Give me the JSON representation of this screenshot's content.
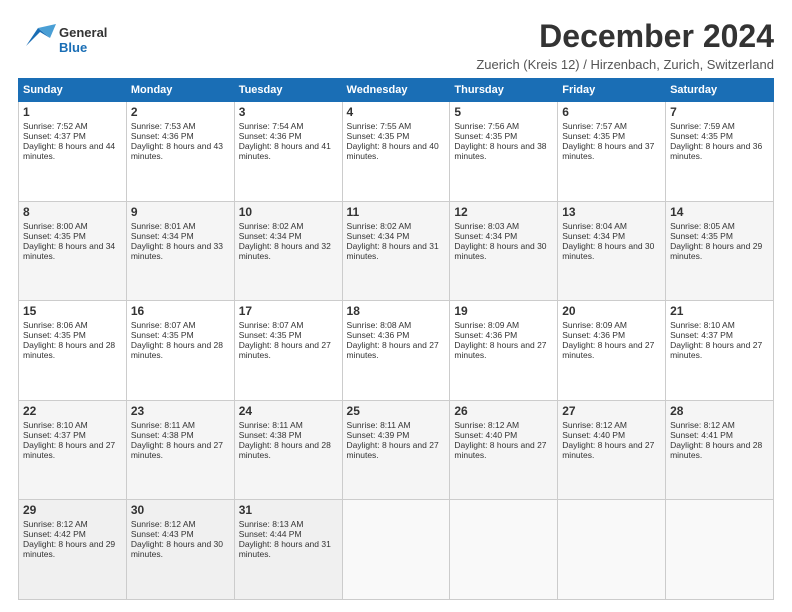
{
  "header": {
    "logo_general": "General",
    "logo_blue": "Blue",
    "month_title": "December 2024",
    "location": "Zuerich (Kreis 12) / Hirzenbach, Zurich, Switzerland"
  },
  "weekdays": [
    "Sunday",
    "Monday",
    "Tuesday",
    "Wednesday",
    "Thursday",
    "Friday",
    "Saturday"
  ],
  "weeks": [
    [
      {
        "day": "1",
        "sun": "Sunrise: 7:52 AM",
        "set": "Sunset: 4:37 PM",
        "day_light": "Daylight: 8 hours and 44 minutes."
      },
      {
        "day": "2",
        "sun": "Sunrise: 7:53 AM",
        "set": "Sunset: 4:36 PM",
        "day_light": "Daylight: 8 hours and 43 minutes."
      },
      {
        "day": "3",
        "sun": "Sunrise: 7:54 AM",
        "set": "Sunset: 4:36 PM",
        "day_light": "Daylight: 8 hours and 41 minutes."
      },
      {
        "day": "4",
        "sun": "Sunrise: 7:55 AM",
        "set": "Sunset: 4:35 PM",
        "day_light": "Daylight: 8 hours and 40 minutes."
      },
      {
        "day": "5",
        "sun": "Sunrise: 7:56 AM",
        "set": "Sunset: 4:35 PM",
        "day_light": "Daylight: 8 hours and 38 minutes."
      },
      {
        "day": "6",
        "sun": "Sunrise: 7:57 AM",
        "set": "Sunset: 4:35 PM",
        "day_light": "Daylight: 8 hours and 37 minutes."
      },
      {
        "day": "7",
        "sun": "Sunrise: 7:59 AM",
        "set": "Sunset: 4:35 PM",
        "day_light": "Daylight: 8 hours and 36 minutes."
      }
    ],
    [
      {
        "day": "8",
        "sun": "Sunrise: 8:00 AM",
        "set": "Sunset: 4:35 PM",
        "day_light": "Daylight: 8 hours and 34 minutes."
      },
      {
        "day": "9",
        "sun": "Sunrise: 8:01 AM",
        "set": "Sunset: 4:34 PM",
        "day_light": "Daylight: 8 hours and 33 minutes."
      },
      {
        "day": "10",
        "sun": "Sunrise: 8:02 AM",
        "set": "Sunset: 4:34 PM",
        "day_light": "Daylight: 8 hours and 32 minutes."
      },
      {
        "day": "11",
        "sun": "Sunrise: 8:02 AM",
        "set": "Sunset: 4:34 PM",
        "day_light": "Daylight: 8 hours and 31 minutes."
      },
      {
        "day": "12",
        "sun": "Sunrise: 8:03 AM",
        "set": "Sunset: 4:34 PM",
        "day_light": "Daylight: 8 hours and 30 minutes."
      },
      {
        "day": "13",
        "sun": "Sunrise: 8:04 AM",
        "set": "Sunset: 4:34 PM",
        "day_light": "Daylight: 8 hours and 30 minutes."
      },
      {
        "day": "14",
        "sun": "Sunrise: 8:05 AM",
        "set": "Sunset: 4:35 PM",
        "day_light": "Daylight: 8 hours and 29 minutes."
      }
    ],
    [
      {
        "day": "15",
        "sun": "Sunrise: 8:06 AM",
        "set": "Sunset: 4:35 PM",
        "day_light": "Daylight: 8 hours and 28 minutes."
      },
      {
        "day": "16",
        "sun": "Sunrise: 8:07 AM",
        "set": "Sunset: 4:35 PM",
        "day_light": "Daylight: 8 hours and 28 minutes."
      },
      {
        "day": "17",
        "sun": "Sunrise: 8:07 AM",
        "set": "Sunset: 4:35 PM",
        "day_light": "Daylight: 8 hours and 27 minutes."
      },
      {
        "day": "18",
        "sun": "Sunrise: 8:08 AM",
        "set": "Sunset: 4:36 PM",
        "day_light": "Daylight: 8 hours and 27 minutes."
      },
      {
        "day": "19",
        "sun": "Sunrise: 8:09 AM",
        "set": "Sunset: 4:36 PM",
        "day_light": "Daylight: 8 hours and 27 minutes."
      },
      {
        "day": "20",
        "sun": "Sunrise: 8:09 AM",
        "set": "Sunset: 4:36 PM",
        "day_light": "Daylight: 8 hours and 27 minutes."
      },
      {
        "day": "21",
        "sun": "Sunrise: 8:10 AM",
        "set": "Sunset: 4:37 PM",
        "day_light": "Daylight: 8 hours and 27 minutes."
      }
    ],
    [
      {
        "day": "22",
        "sun": "Sunrise: 8:10 AM",
        "set": "Sunset: 4:37 PM",
        "day_light": "Daylight: 8 hours and 27 minutes."
      },
      {
        "day": "23",
        "sun": "Sunrise: 8:11 AM",
        "set": "Sunset: 4:38 PM",
        "day_light": "Daylight: 8 hours and 27 minutes."
      },
      {
        "day": "24",
        "sun": "Sunrise: 8:11 AM",
        "set": "Sunset: 4:38 PM",
        "day_light": "Daylight: 8 hours and 28 minutes."
      },
      {
        "day": "25",
        "sun": "Sunrise: 8:11 AM",
        "set": "Sunset: 4:39 PM",
        "day_light": "Daylight: 8 hours and 27 minutes."
      },
      {
        "day": "26",
        "sun": "Sunrise: 8:12 AM",
        "set": "Sunset: 4:40 PM",
        "day_light": "Daylight: 8 hours and 27 minutes."
      },
      {
        "day": "27",
        "sun": "Sunrise: 8:12 AM",
        "set": "Sunset: 4:40 PM",
        "day_light": "Daylight: 8 hours and 27 minutes."
      },
      {
        "day": "28",
        "sun": "Sunrise: 8:12 AM",
        "set": "Sunset: 4:41 PM",
        "day_light": "Daylight: 8 hours and 28 minutes."
      }
    ],
    [
      {
        "day": "29",
        "sun": "Sunrise: 8:12 AM",
        "set": "Sunset: 4:42 PM",
        "day_light": "Daylight: 8 hours and 29 minutes."
      },
      {
        "day": "30",
        "sun": "Sunrise: 8:12 AM",
        "set": "Sunset: 4:43 PM",
        "day_light": "Daylight: 8 hours and 30 minutes."
      },
      {
        "day": "31",
        "sun": "Sunrise: 8:13 AM",
        "set": "Sunset: 4:44 PM",
        "day_light": "Daylight: 8 hours and 31 minutes."
      },
      null,
      null,
      null,
      null
    ]
  ]
}
